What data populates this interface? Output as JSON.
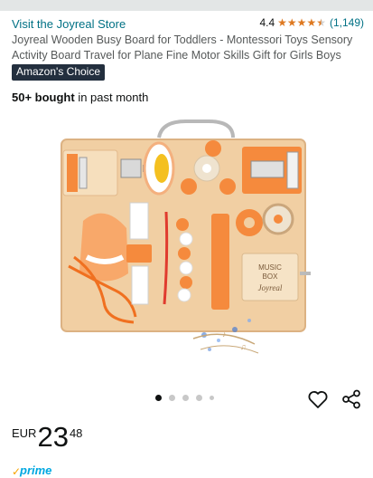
{
  "store": {
    "link_text": "Visit the Joyreal Store"
  },
  "rating": {
    "value": "4.4",
    "stars": 4.4,
    "count": "(1,149)",
    "star_color": "#de7921"
  },
  "product": {
    "title": "Joyreal Wooden Busy Board for Toddlers - Montessori Toys Sensory Activity Board Travel for Plane Fine Motor Skills Gift for Girls Boys",
    "badge": "Amazon's Choice",
    "bought_bold": "50+ bought",
    "bought_rest": " in past month"
  },
  "image_labels": {
    "box_line1": "MUSIC",
    "box_line2": "BOX",
    "box_brand": "Joyreal"
  },
  "gallery": {
    "total": 5,
    "current": 1
  },
  "icons": {
    "favorite": "heart-icon",
    "share": "share-icon",
    "prime_check": "check-icon"
  },
  "price": {
    "currency": "EUR",
    "whole": "23",
    "fraction": "48"
  },
  "prime": {
    "label": "prime",
    "color": "#00a8e1"
  },
  "colors": {
    "link": "#007185",
    "badge_bg": "#232f3e",
    "orange": "#f58a3d"
  }
}
